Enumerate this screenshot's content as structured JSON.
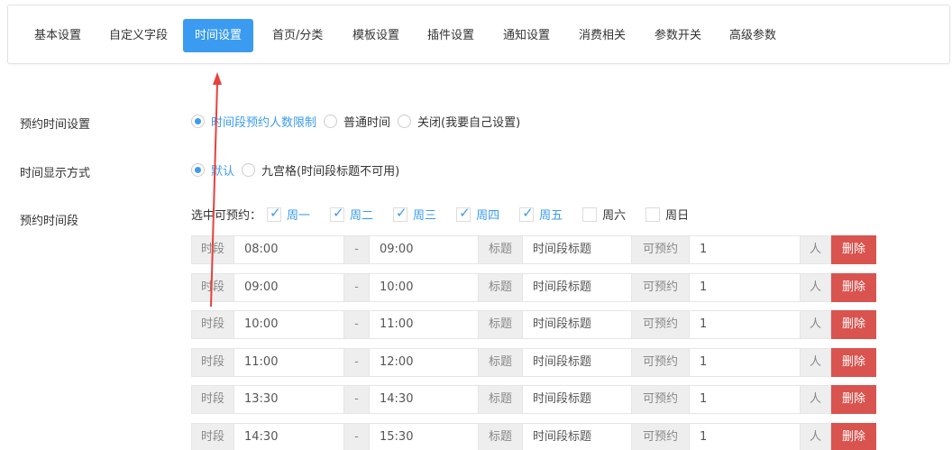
{
  "tabs": [
    {
      "label": "基本设置",
      "active": false
    },
    {
      "label": "自定义字段",
      "active": false
    },
    {
      "label": "时间设置",
      "active": true
    },
    {
      "label": "首页/分类",
      "active": false
    },
    {
      "label": "模板设置",
      "active": false
    },
    {
      "label": "插件设置",
      "active": false
    },
    {
      "label": "通知设置",
      "active": false
    },
    {
      "label": "消费相关",
      "active": false
    },
    {
      "label": "参数开关",
      "active": false
    },
    {
      "label": "高级参数",
      "active": false
    }
  ],
  "booking_time": {
    "label": "预约时间设置",
    "options": [
      "时间段预约人数限制",
      "普通时间",
      "关闭(我要自己设置)"
    ],
    "selected": 0
  },
  "display_mode": {
    "label": "时间显示方式",
    "options": [
      "默认",
      "九宫格(时间段标题不可用)"
    ],
    "selected": 0
  },
  "time_slots": {
    "label": "预约时间段",
    "days_label": "选中可预约：",
    "days": [
      {
        "label": "周一",
        "checked": true
      },
      {
        "label": "周二",
        "checked": true
      },
      {
        "label": "周三",
        "checked": true
      },
      {
        "label": "周四",
        "checked": true
      },
      {
        "label": "周五",
        "checked": true
      },
      {
        "label": "周六",
        "checked": false
      },
      {
        "label": "周日",
        "checked": false
      }
    ],
    "slot_label": "时段",
    "separator": "-",
    "title_label": "标题",
    "title_placeholder": "时间段标题",
    "capacity_label": "可预约",
    "unit": "人",
    "delete_label": "删除",
    "rows": [
      {
        "start": "08:00",
        "end": "09:00",
        "capacity": "1"
      },
      {
        "start": "09:00",
        "end": "10:00",
        "capacity": "1"
      },
      {
        "start": "10:00",
        "end": "11:00",
        "capacity": "1"
      },
      {
        "start": "11:00",
        "end": "12:00",
        "capacity": "1"
      },
      {
        "start": "13:30",
        "end": "14:30",
        "capacity": "1"
      },
      {
        "start": "14:30",
        "end": "15:30",
        "capacity": "1"
      }
    ]
  },
  "colors": {
    "accent": "#3a9bf0",
    "danger": "#d9534f",
    "annotation_arrow": "#e8413c"
  }
}
